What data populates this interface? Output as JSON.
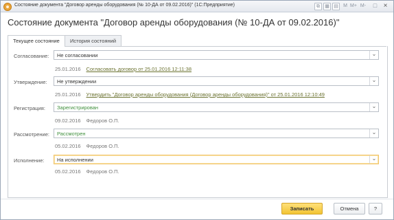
{
  "window": {
    "title": "Состояние документа \"Договор аренды оборудования (№ 10-ДА от 09.02.2016)\" (1С:Предприятие)",
    "controls": {
      "m": "M",
      "mplus": "M+",
      "mminus": "M-",
      "restore": "□",
      "close": "×"
    }
  },
  "page_title": "Состояние документа \"Договор аренды оборудования (№ 10-ДА от 09.02.2016)\"",
  "tabs": [
    {
      "label": "Текущее состояние"
    },
    {
      "label": "История состояний"
    }
  ],
  "rows": [
    {
      "label": "Согласование:",
      "value": "Не согласовании",
      "date": "25.01.2016",
      "link": "Согласовать договор от 25.01.2016 12:11:38"
    },
    {
      "label": "Утверждение:",
      "value": "Не утверждении",
      "date": "25.01.2016",
      "link": "Утвердить \"Договор аренды оборудования (Договор аренды оборудования)\" от 25.01.2016 12:10:49"
    },
    {
      "label": "Регистрация:",
      "value": "Зарегистрирован",
      "date": "09.02.2016",
      "who": "Федоров О.П."
    },
    {
      "label": "Рассмотрение:",
      "value": "Рассмотрен",
      "date": "05.02.2016",
      "who": "Федоров О.П."
    },
    {
      "label": "Исполнение:",
      "value": "На исполнении",
      "date": "05.02.2016",
      "who": "Федоров О.П."
    }
  ],
  "buttons": {
    "save": "Записать",
    "cancel": "Отмена",
    "help": "?"
  },
  "colors": {
    "accent": "#f2c434",
    "green_value": "#3f8f3c",
    "link": "#6b7230"
  }
}
